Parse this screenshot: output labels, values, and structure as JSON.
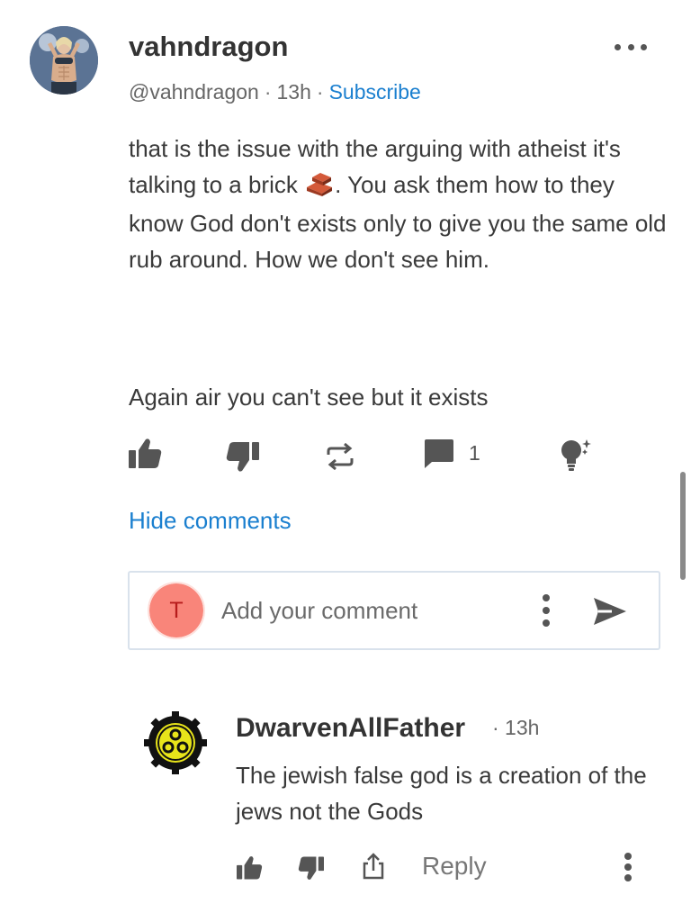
{
  "post": {
    "username": "vahndragon",
    "handle": "@vahndragon",
    "separator": "·",
    "time": "13h",
    "subscribe_label": "Subscribe",
    "body_before_emoji": "that is the issue with the arguing with atheist it's talking to a brick",
    "body_after_emoji": ". You ask them how to they know God don't exists only to give you the same old rub around. How we don't see him.",
    "body_second": "Again air you can't see but it exists",
    "comment_count": "1",
    "hide_comments_label": "Hide comments"
  },
  "comment_input": {
    "avatar_letter": "T",
    "placeholder": "Add your comment"
  },
  "reply": {
    "username": "DwarvenAllFather",
    "time": "· 13h",
    "body": "The jewish false god is a creation of the jews not the Gods",
    "reply_label": "Reply"
  },
  "icons": {
    "like": "thumbs-up-icon",
    "dislike": "thumbs-down-icon",
    "restack": "repeat-icon",
    "comment": "comment-icon",
    "idea": "lightbulb-sparkle-icon",
    "share": "share-icon",
    "more": "more-dots-icon",
    "send": "send-icon",
    "brick": "brick-emoji"
  },
  "colors": {
    "link": "#1a7fcf",
    "icon": "#555555",
    "input_border": "#d9e2ec",
    "avatar_t": "#f9857a",
    "avatar_reply_bg": "#e8e41a"
  }
}
